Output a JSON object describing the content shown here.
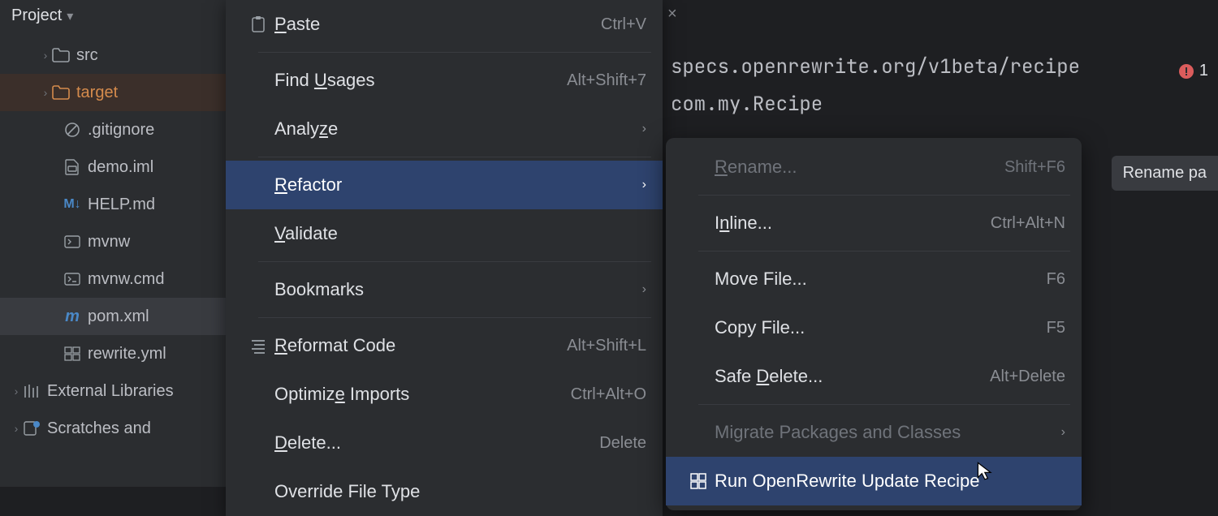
{
  "project": {
    "header": "Project"
  },
  "tree": {
    "src": "src",
    "target": "target",
    "gitignore": ".gitignore",
    "demo_iml": "demo.iml",
    "help_md": "HELP.md",
    "mvnw": "mvnw",
    "mvnw_cmd": "mvnw.cmd",
    "pom_xml": "pom.xml",
    "rewrite_yml": "rewrite.yml",
    "ext_lib": "External Libraries",
    "scratches": "Scratches and"
  },
  "main_menu": [
    {
      "label": "Paste",
      "shortcut": "Ctrl+V",
      "icon": "paste",
      "u": 0
    },
    {
      "sep": true
    },
    {
      "label": "Find Usages",
      "shortcut": "Alt+Shift+7",
      "u": 5
    },
    {
      "label": "Analyze",
      "submenu": true,
      "u": 5
    },
    {
      "sep": true
    },
    {
      "label": "Refactor",
      "submenu": true,
      "highlight": true,
      "u": 0
    },
    {
      "label": "Validate",
      "u": 0
    },
    {
      "sep": true
    },
    {
      "label": "Bookmarks",
      "submenu": true
    },
    {
      "sep": true
    },
    {
      "label": "Reformat Code",
      "shortcut": "Alt+Shift+L",
      "icon": "reformat",
      "u": 0
    },
    {
      "label": "Optimize Imports",
      "shortcut": "Ctrl+Alt+O",
      "u": 7
    },
    {
      "label": "Delete...",
      "shortcut": "Delete",
      "u": 0
    },
    {
      "label": "Override File Type"
    }
  ],
  "refactor_menu": [
    {
      "label": "Rename...",
      "shortcut": "Shift+F6",
      "disabled": true,
      "u": 0
    },
    {
      "sep": true
    },
    {
      "label": "Inline...",
      "shortcut": "Ctrl+Alt+N",
      "u": 1
    },
    {
      "sep": true
    },
    {
      "label": "Move File...",
      "shortcut": "F6"
    },
    {
      "label": "Copy File...",
      "shortcut": "F5"
    },
    {
      "label": "Safe Delete...",
      "shortcut": "Alt+Delete",
      "u": 5
    },
    {
      "sep": true
    },
    {
      "label": "Migrate Packages and Classes",
      "submenu": true,
      "disabled": true
    },
    {
      "label": "Run OpenRewrite Update Recipe",
      "icon": "rewrite",
      "highlight": true,
      "u": 31
    }
  ],
  "editor": {
    "line1": "specs.openrewrite.org/v1beta/recipe",
    "line2": "com.my.Recipe"
  },
  "tooltip": "Rename pa",
  "error_count": "1"
}
